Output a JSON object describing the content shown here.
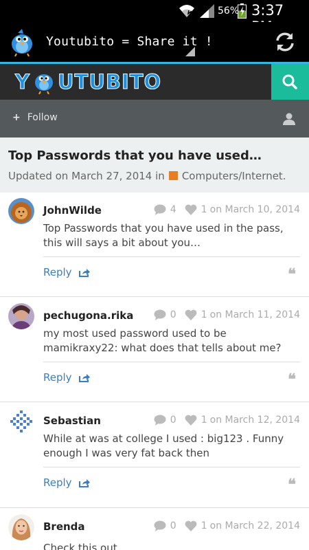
{
  "status_bar": {
    "battery_percent": "56%",
    "time": "3:37 PM"
  },
  "app_bar": {
    "title": "Youtubito = Share it !",
    "icons": [
      "app-bird-icon",
      "dropdown-triangle-icon",
      "refresh-icon"
    ]
  },
  "site_header": {
    "logo_text": "UTUBITO",
    "logo_prefix": "Y",
    "icons": [
      "search-icon"
    ],
    "accent_color": "#1abc9c"
  },
  "follow_bar": {
    "follow_label": "Follow",
    "icons": [
      "plus-icon",
      "user-icon"
    ]
  },
  "post": {
    "title": "Top Passwords that you have used…",
    "updated_prefix": "Updated on March 27, 2014 in",
    "category": "Computers/Internet.",
    "category_color": "#e67e22"
  },
  "comments": [
    {
      "author": "JohnWilde",
      "comment_count": "4",
      "likes": "1",
      "date": "on March 10, 2014",
      "body": "Top Passwords that you have used in the pass, this will says a bit about you…",
      "reply_label": "Reply",
      "avatar": "lion-avatar"
    },
    {
      "author": "pechugona.rika",
      "comment_count": "0",
      "likes": "1",
      "date": "on March 11, 2014",
      "body": "my most used password used to be mamikraxy22: what does that tells about me?",
      "reply_label": "Reply",
      "avatar": "person-avatar"
    },
    {
      "author": "Sebastian",
      "comment_count": "0",
      "likes": "1",
      "date": "on March 12, 2014",
      "body": "While at was at college I used : big123 . Funny enough I was very fat back then",
      "reply_label": "Reply",
      "avatar": "pattern-avatar"
    },
    {
      "author": "Brenda",
      "comment_count": "0",
      "likes": "1",
      "date": "on March 22, 2014",
      "body": "Check this out",
      "reply_label": "Reply",
      "avatar": "woman-avatar"
    }
  ],
  "colors": {
    "link": "#3b7dc4",
    "holo_blue": "#33b5e5",
    "follow_bar": "#54595c",
    "title_bg": "#ecf0f1"
  }
}
